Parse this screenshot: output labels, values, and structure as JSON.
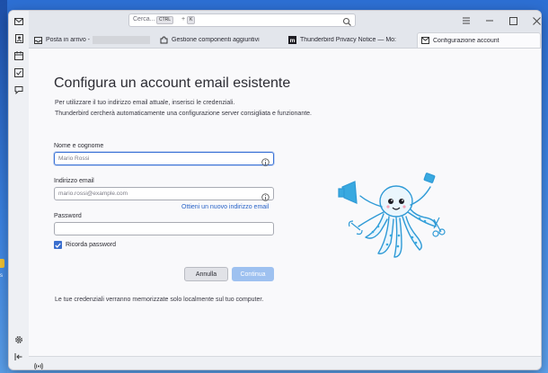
{
  "search": {
    "placeholder": "Cerca...",
    "shortcut_key1": "CTRL",
    "shortcut_plus": "+",
    "shortcut_key2": "K"
  },
  "tabs": [
    {
      "label": "Posta in arrivo - ",
      "icon": "inbox-icon"
    },
    {
      "label": "Gestione componenti aggiuntivi",
      "icon": "puzzle-icon"
    },
    {
      "label": "Thunderbird Privacy Notice — Mo:",
      "icon": "mozilla-icon"
    },
    {
      "label": "Configurazione account",
      "icon": "account-setup-icon"
    }
  ],
  "form": {
    "title": "Configura un account email esistente",
    "description_line1": "Per utilizzare il tuo indirizzo email attuale, inserisci le credenziali.",
    "description_line2": "Thunderbird cercherà automaticamente una configurazione server consigliata e funzionante.",
    "name_label": "Nome e cognome",
    "name_placeholder": "Mario Rossi",
    "email_label": "Indirizzo email",
    "email_placeholder": "mario.rossi@example.com",
    "new_address_link": "Ottieni un nuovo indirizzo email",
    "password_label": "Password",
    "password_value": "",
    "remember_label": "Ricorda password",
    "remember_checked": true,
    "cancel_label": "Annulla",
    "continue_label": "Continua",
    "footer_note": "Le tue credenziali verranno memorizzate solo localmente sul tuo computer."
  },
  "colors": {
    "accent": "#3b6fce",
    "link": "#2762c7",
    "continue_disabled": "#9ec1f0",
    "mascot": "#39a9e0"
  }
}
